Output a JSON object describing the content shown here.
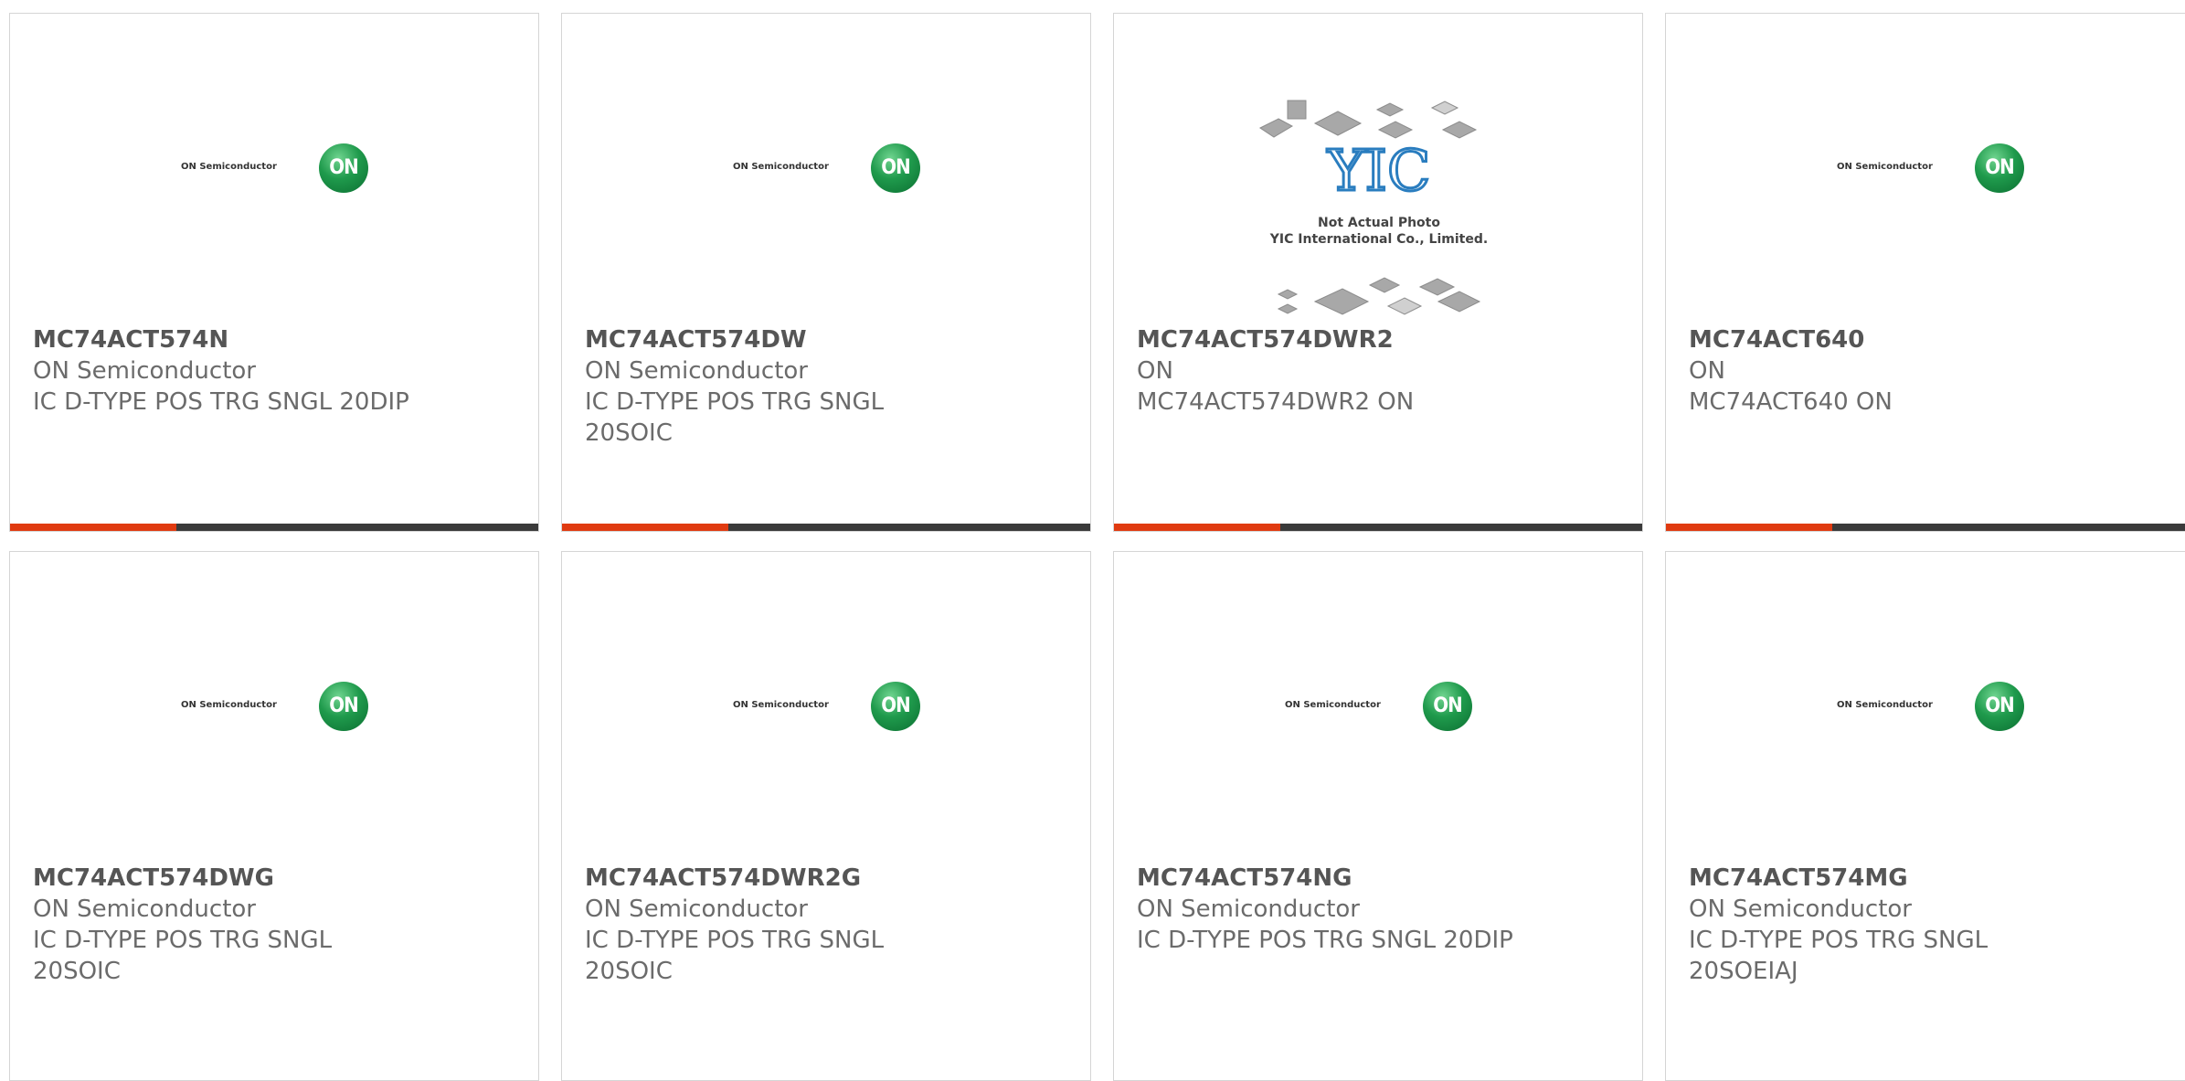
{
  "colors": {
    "accent": "#e03a10",
    "bar": "#3a3a3a",
    "on_green": "#1f9a4c"
  },
  "logo": {
    "on_text": "ON Semiconductor",
    "on_badge": "ON",
    "yic_caption_1": "Not Actual Photo",
    "yic_caption_2": "YIC International Co., Limited.",
    "yic_mark": "YIC"
  },
  "products": [
    {
      "part": "MC74ACT574N",
      "mfr": "ON Semiconductor",
      "desc": "IC D-TYPE POS TRG SNGL 20DIP",
      "image": "on-semiconductor-logo",
      "accent_fraction": 0.315
    },
    {
      "part": "MC74ACT574DW",
      "mfr": "ON Semiconductor",
      "desc": "IC D-TYPE POS TRG SNGL 20SOIC",
      "image": "on-semiconductor-logo",
      "accent_fraction": 0.315
    },
    {
      "part": "MC74ACT574DWR2",
      "mfr": "ON",
      "desc": "MC74ACT574DWR2 ON",
      "image": "yic-not-actual-photo",
      "accent_fraction": 0.315
    },
    {
      "part": "MC74ACT640",
      "mfr": "ON",
      "desc": "MC74ACT640 ON",
      "image": "on-semiconductor-logo",
      "accent_fraction": 0.315
    },
    {
      "part": "MC74ACT574DWG",
      "mfr": "ON Semiconductor",
      "desc": "IC D-TYPE POS TRG SNGL 20SOIC",
      "image": "on-semiconductor-logo"
    },
    {
      "part": "MC74ACT574DWR2G",
      "mfr": "ON Semiconductor",
      "desc": "IC D-TYPE POS TRG SNGL 20SOIC",
      "image": "on-semiconductor-logo"
    },
    {
      "part": "MC74ACT574NG",
      "mfr": "ON Semiconductor",
      "desc": "IC D-TYPE POS TRG SNGL 20DIP",
      "image": "on-semiconductor-logo"
    },
    {
      "part": "MC74ACT574MG",
      "mfr": "ON Semiconductor",
      "desc": "IC D-TYPE POS TRG SNGL 20SOEIAJ",
      "image": "on-semiconductor-logo"
    }
  ]
}
